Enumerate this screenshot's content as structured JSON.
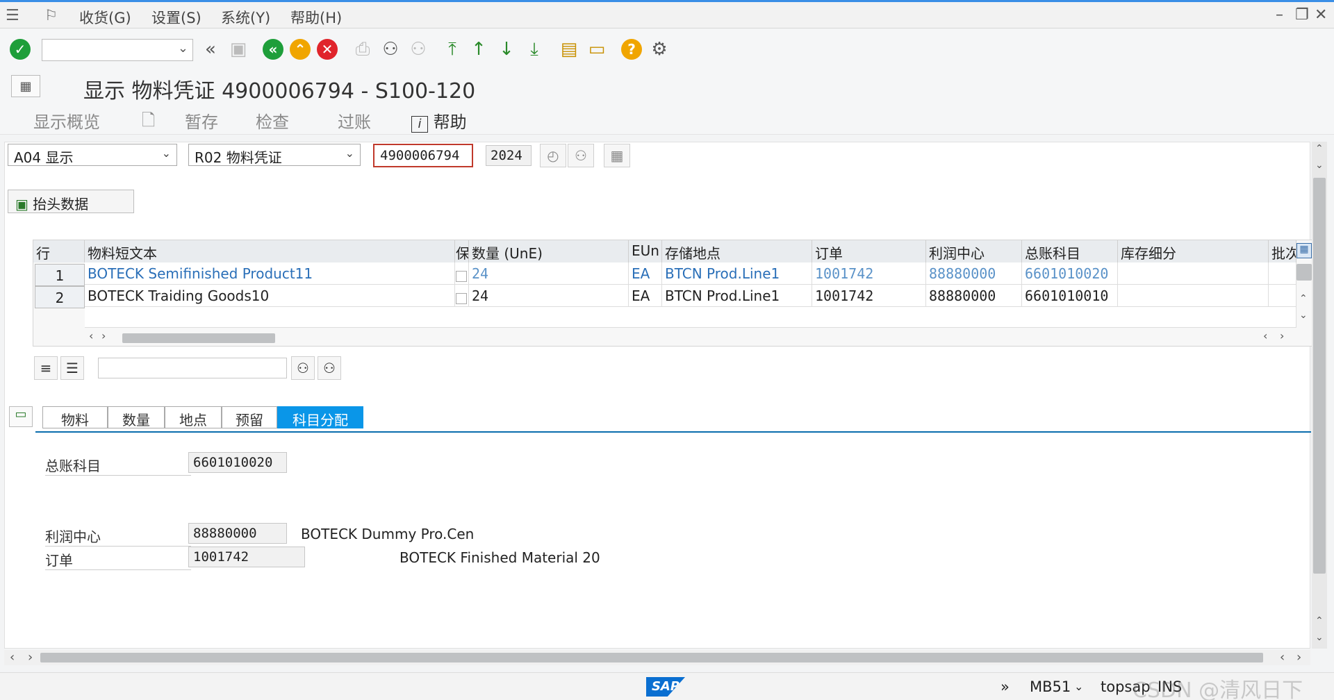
{
  "menu": {
    "items": [
      "收货(G)",
      "设置(S)",
      "系统(Y)",
      "帮助(H)"
    ]
  },
  "toolbar": {
    "command_value": "",
    "icons": [
      "enter-icon",
      "back-icon",
      "exit-icon",
      "cancel-icon",
      "print-icon",
      "find-icon",
      "find-next-icon",
      "first-page-icon",
      "prev-page-icon",
      "next-page-icon",
      "last-page-icon",
      "new-session-icon",
      "shortcut-icon",
      "help-icon",
      "settings-icon"
    ]
  },
  "title": "显示 物料凭证 4900006794 - S100-120",
  "appbar": {
    "overview": "显示概览",
    "hold": "暂存",
    "check": "检查",
    "post": "过账",
    "help": "帮助"
  },
  "header": {
    "action": "A04 显示",
    "reference": "R02 物料凭证",
    "doc_number": "4900006794",
    "year": "2024",
    "header_data_button": "抬头数据"
  },
  "grid": {
    "columns": [
      "行",
      "物料短文本",
      "保",
      "数量 (UnE)",
      "EUn",
      "存储地点",
      "订单",
      "利润中心",
      "总账科目",
      "库存细分",
      "批次"
    ],
    "rows": [
      {
        "line": "1",
        "text": "BOTECK Semifinished Product11",
        "qty": "24",
        "eun": "EA",
        "sloc": "BTCN Prod.Line1",
        "order": "1001742",
        "profit_center": "88880000",
        "gl": "6601010020",
        "stock": ""
      },
      {
        "line": "2",
        "text": "BOTECK Traiding Goods10",
        "qty": "24",
        "eun": "EA",
        "sloc": "BTCN Prod.Line1",
        "order": "1001742",
        "profit_center": "88880000",
        "gl": "6601010010",
        "stock": ""
      }
    ],
    "search_value": ""
  },
  "tabs": [
    "物料",
    "数量",
    "地点",
    "预留",
    "科目分配"
  ],
  "active_tab": "科目分配",
  "detail": {
    "gl_label": "总账科目",
    "gl_value": "6601010020",
    "pc_label": "利润中心",
    "pc_value": "88880000",
    "pc_desc": "BOTECK Dummy Pro.Cen",
    "order_label": "订单",
    "order_value": "1001742",
    "order_desc": "BOTECK Finished Material 20"
  },
  "status": {
    "transaction": "MB51",
    "system": "topsap",
    "mode": "INS",
    "watermark": "CSDN @清风日下"
  },
  "colors": {
    "accent": "#0a96e8",
    "link": "#2a6fb8",
    "enter": "#1e9e3a",
    "back": "#1e9e3a",
    "exit": "#f0a500",
    "cancel": "#e0242b",
    "help": "#f0a500"
  }
}
